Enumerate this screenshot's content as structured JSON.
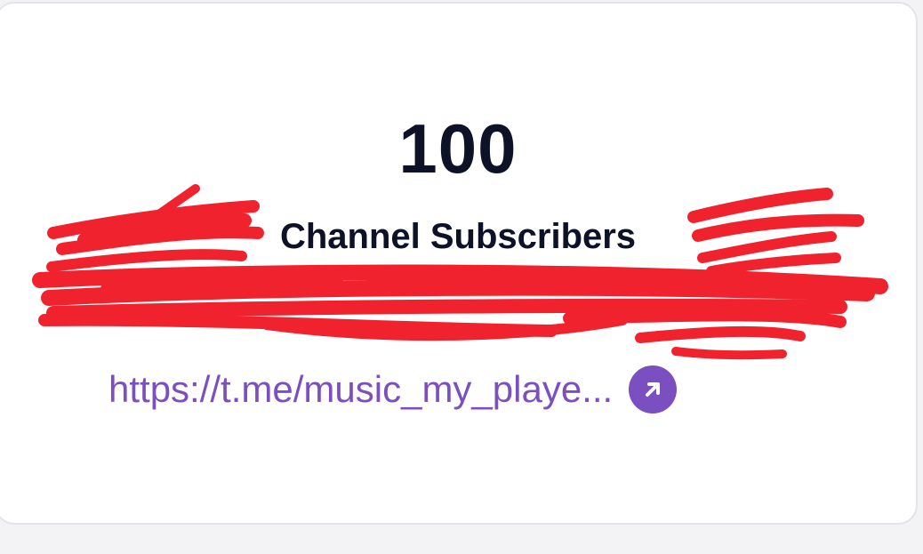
{
  "card": {
    "count": "100",
    "description": "Channel Subscribers",
    "link_text": "https://t.me/music_my_playe...",
    "link_icon": "arrow-up-right-icon"
  },
  "colors": {
    "accent": "#7b4fbf",
    "text": "#0d1226",
    "redaction": "#f0222e"
  }
}
